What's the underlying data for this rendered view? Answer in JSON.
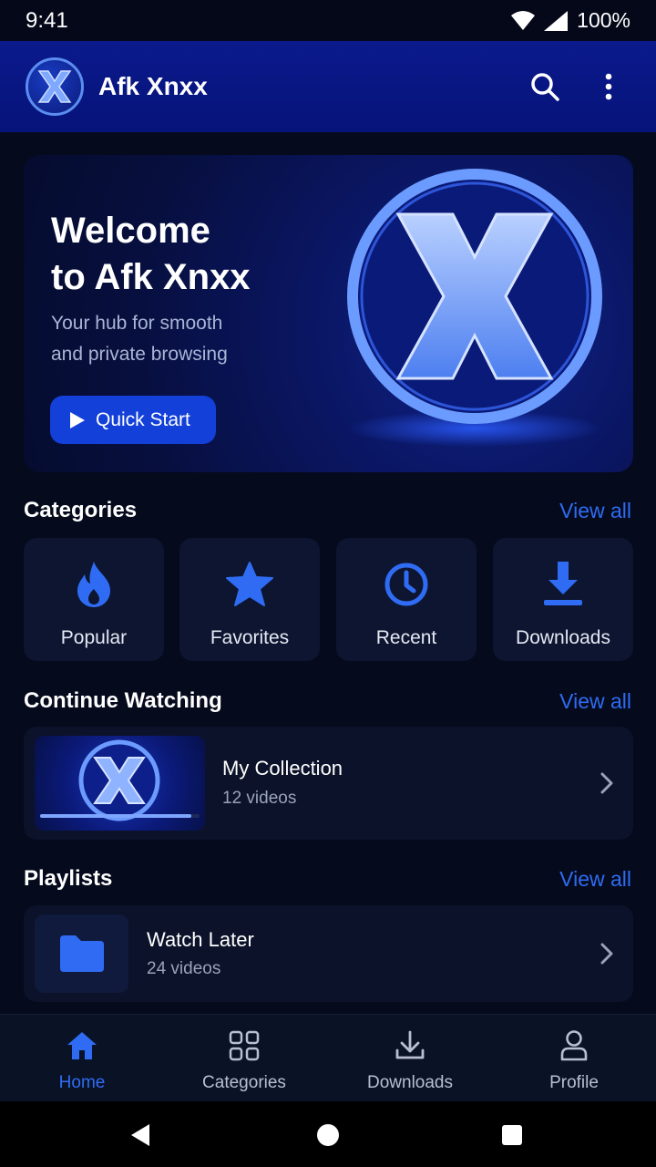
{
  "status": {
    "time": "9:41",
    "battery": "100%"
  },
  "app": {
    "title": "Afk Xnxx",
    "logo_letter": "X"
  },
  "hero": {
    "title_line1": "Welcome",
    "title_line2": "to Afk Xnxx",
    "subtitle_line1": "Your hub for smooth",
    "subtitle_line2": "and private browsing",
    "cta": "Quick Start",
    "art_letter": "X"
  },
  "categories": {
    "title": "Categories",
    "view_all": "View all",
    "items": [
      {
        "label": "Popular",
        "icon": "flame-icon"
      },
      {
        "label": "Favorites",
        "icon": "star-icon"
      },
      {
        "label": "Recent",
        "icon": "clock-icon"
      },
      {
        "label": "Downloads",
        "icon": "download-icon"
      }
    ]
  },
  "continue_watching": {
    "title": "Continue Watching",
    "view_all": "View all",
    "item": {
      "title": "My Collection",
      "subtitle": "12 videos",
      "thumb_letter": "X",
      "progress": 0.95
    }
  },
  "playlists": {
    "title": "Playlists",
    "view_all": "View all",
    "item": {
      "title": "Watch Later",
      "subtitle": "24 videos",
      "icon": "folder-icon"
    }
  },
  "bottom_nav": {
    "items": [
      {
        "label": "Home",
        "icon": "home-icon",
        "active": true
      },
      {
        "label": "Categories",
        "icon": "grid-icon",
        "active": false
      },
      {
        "label": "Downloads",
        "icon": "download-icon",
        "active": false
      },
      {
        "label": "Profile",
        "icon": "person-icon",
        "active": false
      }
    ]
  },
  "colors": {
    "accent": "#2f6cf3",
    "app_bar": "#0b1a8c",
    "background": "#050a1c",
    "card": "#0d1530"
  }
}
